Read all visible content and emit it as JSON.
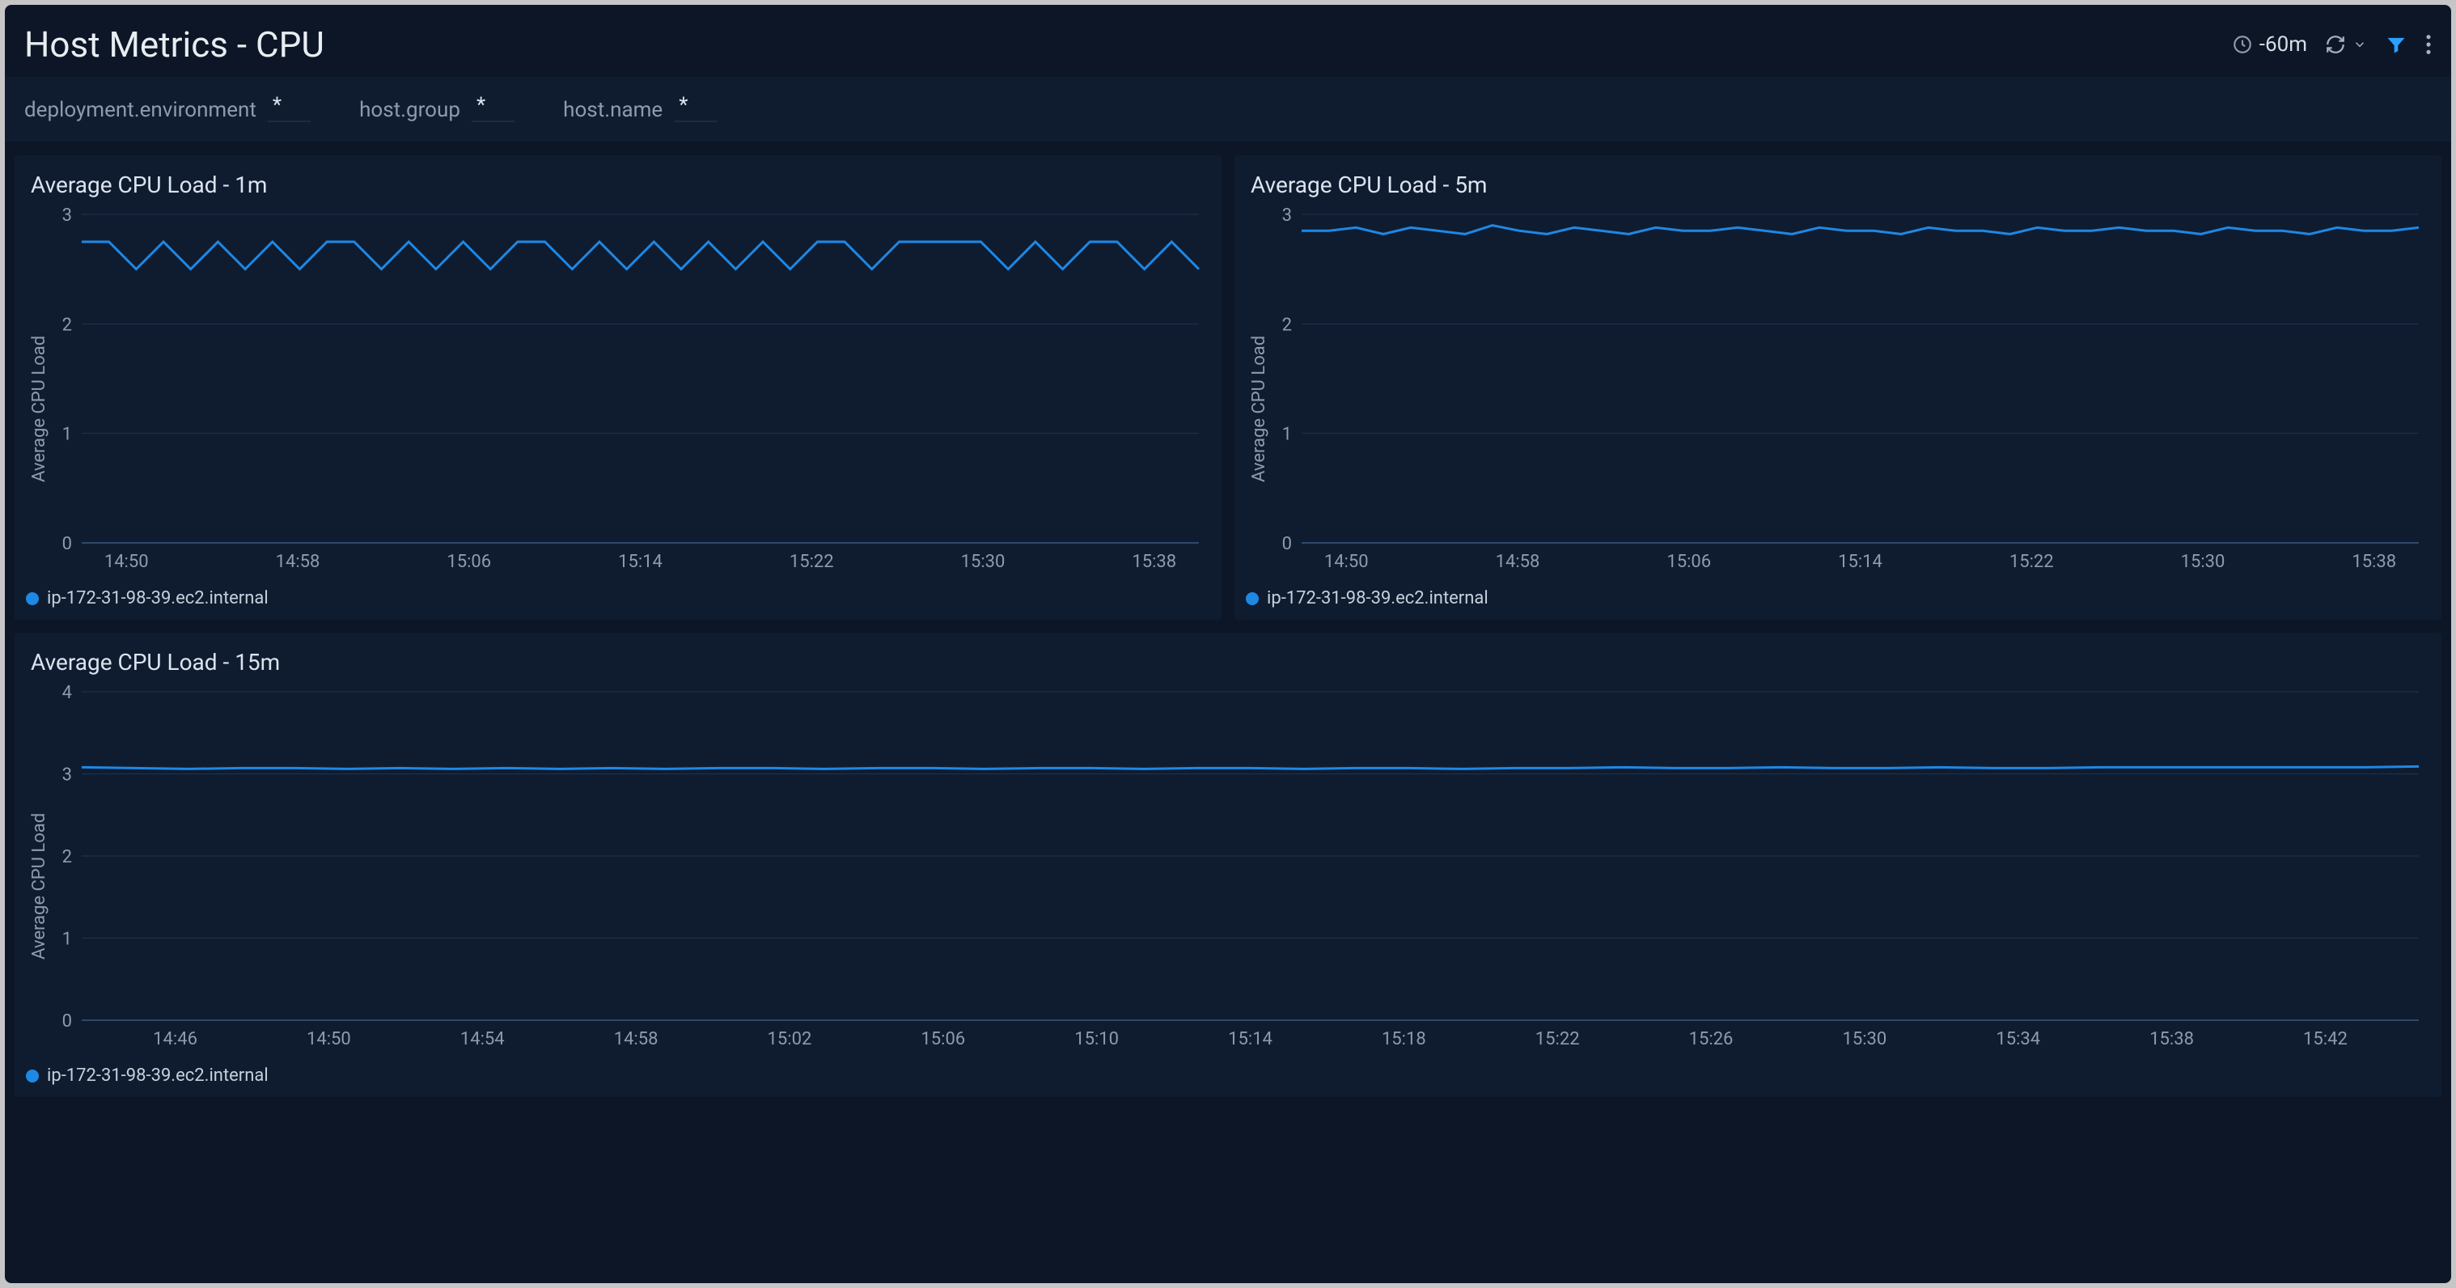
{
  "header": {
    "title": "Host Metrics - CPU",
    "time_range": "-60m"
  },
  "filters": [
    {
      "label": "deployment.environment",
      "value": "*"
    },
    {
      "label": "host.group",
      "value": "*"
    },
    {
      "label": "host.name",
      "value": "*"
    }
  ],
  "legend_host": "ip-172-31-98-39.ec2.internal",
  "chart_data": [
    {
      "id": "cpu-1m",
      "title": "Average CPU Load - 1m",
      "ylabel": "Average CPU Load",
      "type": "line",
      "ylim": [
        0,
        3
      ],
      "yticks": [
        0,
        1,
        2,
        3
      ],
      "x_categories": [
        "14:50",
        "14:58",
        "15:06",
        "15:14",
        "15:22",
        "15:30",
        "15:38"
      ],
      "series": [
        {
          "name": "ip-172-31-98-39.ec2.internal",
          "values": [
            2.75,
            2.75,
            2.5,
            2.75,
            2.5,
            2.75,
            2.5,
            2.75,
            2.5,
            2.75,
            2.75,
            2.5,
            2.75,
            2.5,
            2.75,
            2.5,
            2.75,
            2.75,
            2.5,
            2.75,
            2.5,
            2.75,
            2.5,
            2.75,
            2.5,
            2.75,
            2.5,
            2.75,
            2.75,
            2.5,
            2.75,
            2.75,
            2.75,
            2.75,
            2.5,
            2.75,
            2.5,
            2.75,
            2.75,
            2.5,
            2.75,
            2.5
          ]
        }
      ]
    },
    {
      "id": "cpu-5m",
      "title": "Average CPU Load - 5m",
      "ylabel": "Average CPU Load",
      "type": "line",
      "ylim": [
        0,
        3
      ],
      "yticks": [
        0,
        1,
        2,
        3
      ],
      "x_categories": [
        "14:50",
        "14:58",
        "15:06",
        "15:14",
        "15:22",
        "15:30",
        "15:38"
      ],
      "series": [
        {
          "name": "ip-172-31-98-39.ec2.internal",
          "values": [
            2.85,
            2.85,
            2.88,
            2.82,
            2.88,
            2.85,
            2.82,
            2.9,
            2.85,
            2.82,
            2.88,
            2.85,
            2.82,
            2.88,
            2.85,
            2.85,
            2.88,
            2.85,
            2.82,
            2.88,
            2.85,
            2.85,
            2.82,
            2.88,
            2.85,
            2.85,
            2.82,
            2.88,
            2.85,
            2.85,
            2.88,
            2.85,
            2.85,
            2.82,
            2.88,
            2.85,
            2.85,
            2.82,
            2.88,
            2.85,
            2.85,
            2.88
          ]
        }
      ]
    },
    {
      "id": "cpu-15m",
      "title": "Average CPU Load - 15m",
      "ylabel": "Average CPU Load",
      "type": "line",
      "ylim": [
        0,
        4
      ],
      "yticks": [
        0,
        1,
        2,
        3,
        4
      ],
      "x_categories": [
        "14:46",
        "14:50",
        "14:54",
        "14:58",
        "15:02",
        "15:06",
        "15:10",
        "15:14",
        "15:18",
        "15:22",
        "15:26",
        "15:30",
        "15:34",
        "15:38",
        "15:42"
      ],
      "series": [
        {
          "name": "ip-172-31-98-39.ec2.internal",
          "values": [
            3.08,
            3.07,
            3.06,
            3.07,
            3.07,
            3.06,
            3.07,
            3.06,
            3.07,
            3.06,
            3.07,
            3.06,
            3.07,
            3.07,
            3.06,
            3.07,
            3.07,
            3.06,
            3.07,
            3.07,
            3.06,
            3.07,
            3.07,
            3.06,
            3.07,
            3.07,
            3.06,
            3.07,
            3.07,
            3.08,
            3.07,
            3.07,
            3.08,
            3.07,
            3.07,
            3.08,
            3.07,
            3.07,
            3.08,
            3.08,
            3.08,
            3.08,
            3.08,
            3.08,
            3.09
          ]
        }
      ]
    }
  ]
}
